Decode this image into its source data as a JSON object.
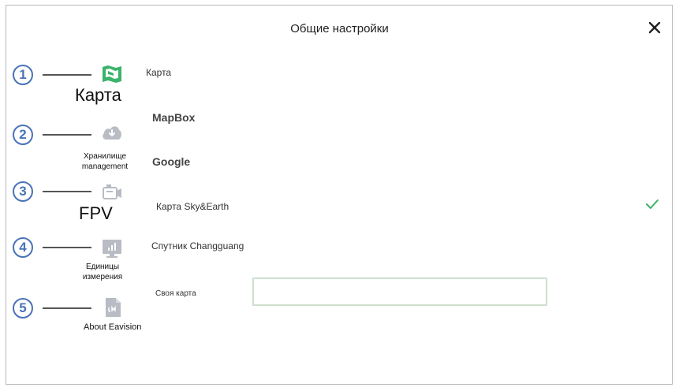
{
  "window": {
    "title": "Общие настройки"
  },
  "colors": {
    "accent": "#3bb36b",
    "callout": "#4a73b8",
    "icon_gray": "#b9bcc4"
  },
  "callouts": [
    "1",
    "2",
    "3",
    "4",
    "5"
  ],
  "sidebar": {
    "items": [
      {
        "icon": "map-icon",
        "label": "Карта",
        "active": true
      },
      {
        "icon": "cloud-download-icon",
        "label_line1": "Хранилище",
        "label_line2": "management"
      },
      {
        "icon": "camera-icon",
        "label": "FPV"
      },
      {
        "icon": "monitor-chart-icon",
        "label_line1": "Единицы",
        "label_line2": "измерения"
      },
      {
        "icon": "document-icon",
        "label": "About Eavision"
      }
    ]
  },
  "main": {
    "section_label": "Карта",
    "options": [
      {
        "label": "MapBox",
        "selected": false
      },
      {
        "label": "Google",
        "selected": false
      },
      {
        "label": "Карта Sky&Earth",
        "selected": true
      },
      {
        "label": "Спутник Changguang",
        "selected": false
      }
    ],
    "custom_map": {
      "label": "Своя карта",
      "value": "",
      "placeholder": ""
    }
  }
}
